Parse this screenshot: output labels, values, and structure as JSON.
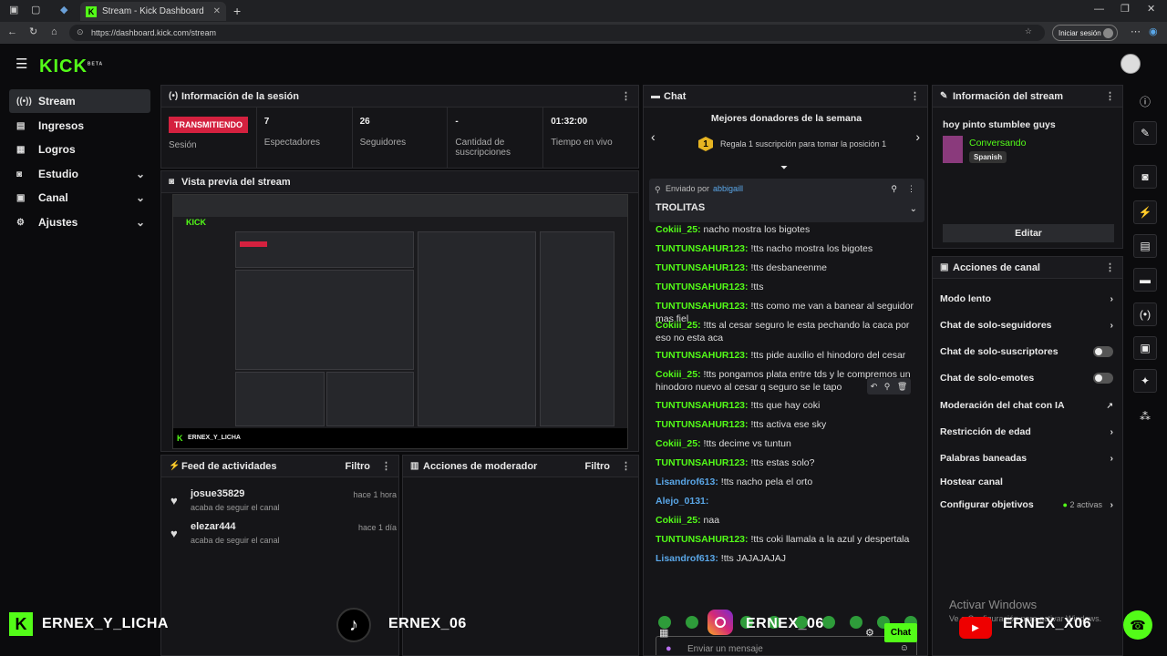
{
  "browser": {
    "tab_title": "Stream - Kick Dashboard",
    "url": "https://dashboard.kick.com/stream",
    "login_label": "Iniciar sesión"
  },
  "app": {
    "logo": "KICK",
    "logo_badge": "BETA"
  },
  "sidebar": {
    "items": [
      {
        "label": "Stream",
        "icon": "broadcast-icon",
        "active": true
      },
      {
        "label": "Ingresos",
        "icon": "money-icon"
      },
      {
        "label": "Logros",
        "icon": "trophy-icon"
      },
      {
        "label": "Estudio",
        "icon": "camera-icon",
        "expandable": true
      },
      {
        "label": "Canal",
        "icon": "tv-icon",
        "expandable": true
      },
      {
        "label": "Ajustes",
        "icon": "gear-icon",
        "expandable": true
      }
    ]
  },
  "session": {
    "title": "Información de la sesión",
    "live_badge": "TRANSMITIENDO",
    "live_label": "Sesión",
    "stats": [
      {
        "value": "7",
        "label": "Espectadores"
      },
      {
        "value": "26",
        "label": "Seguidores"
      },
      {
        "value": "-",
        "label": "Cantidad de suscripciones"
      },
      {
        "value": "01:32:00",
        "label": "Tiempo en vivo"
      }
    ]
  },
  "preview": {
    "title": "Vista previa del stream"
  },
  "overlays": {
    "kick_name": "ERNEX_Y_LICHA",
    "tiktok_name": "ERNEX_06",
    "instagram_name": "ERNEX_06",
    "youtube_name": "ERNEX_X06"
  },
  "feed": {
    "title": "Feed de actividades",
    "filter": "Filtro",
    "items": [
      {
        "name": "josue35829",
        "sub": "acaba de seguir el canal",
        "time": "hace 1 hora"
      },
      {
        "name": "elezar444",
        "sub": "acaba de seguir el canal",
        "time": "hace 1 día"
      }
    ]
  },
  "moderator": {
    "title": "Acciones de moderador",
    "filter": "Filtro"
  },
  "chat": {
    "title": "Chat",
    "donors_title": "Mejores donadores de la semana",
    "donors_text": "Regala 1 suscripción para tomar la posición 1",
    "donors_rank": "1",
    "pinned_by_label": "Enviado por",
    "pinned_by": "abbigaill",
    "pinned_text": "TROLITAS",
    "messages": [
      {
        "user": "Cokiii_25:",
        "text": "nacho mostra los bigotes",
        "color": "green"
      },
      {
        "user": "TUNTUNSAHUR123:",
        "text": "!tts nacho mostra los bigotes",
        "color": "green"
      },
      {
        "user": "TUNTUNSAHUR123:",
        "text": "!tts desbaneenme",
        "color": "green"
      },
      {
        "user": "TUNTUNSAHUR123:",
        "text": "!tts",
        "color": "green"
      },
      {
        "user": "TUNTUNSAHUR123:",
        "text": "!tts como me van a banear al seguidor mas fiel",
        "color": "green"
      },
      {
        "user": "Cokiii_25:",
        "text": "!tts al cesar seguro le esta pechando la caca por eso no esta aca",
        "color": "green"
      },
      {
        "user": "TUNTUNSAHUR123:",
        "text": "!tts pide auxilio el hinodoro del cesar",
        "color": "green"
      },
      {
        "user": "Cokiii_25:",
        "text": "!tts pongamos plata entre tds y le compremos un hinodoro nuevo al cesar q seguro se le tapo",
        "color": "green"
      },
      {
        "user": "TUNTUNSAHUR123:",
        "text": "!tts que hay coki",
        "color": "green"
      },
      {
        "user": "TUNTUNSAHUR123:",
        "text": "!tts activa ese sky",
        "color": "green"
      },
      {
        "user": "Cokiii_25:",
        "text": "!tts decime vs tuntun",
        "color": "green"
      },
      {
        "user": "TUNTUNSAHUR123:",
        "text": "!tts estas solo?",
        "color": "green"
      },
      {
        "user": "Lisandrof613:",
        "text": "!tts nacho pela el orto",
        "color": "blue"
      },
      {
        "user": "Alejo_0131:",
        "text": "",
        "color": "blue"
      },
      {
        "user": "Cokiii_25:",
        "text": "naa",
        "color": "green"
      },
      {
        "user": "TUNTUNSAHUR123:",
        "text": "!tts coki llamala a la azul y despertala",
        "color": "green"
      },
      {
        "user": "Lisandrof613:",
        "text": "!tts JAJAJAJAJ",
        "color": "blue"
      }
    ],
    "input_placeholder": "Enviar un mensaje",
    "send_label": "Chat"
  },
  "stream_info": {
    "title": "Información del stream",
    "stream_title": "hoy pinto stumblee guys",
    "category": "Conversando",
    "language": "Spanish",
    "edit_label": "Editar"
  },
  "channel_actions": {
    "title": "Acciones de canal",
    "items": [
      {
        "label": "Modo lento",
        "kind": "chevron"
      },
      {
        "label": "Chat de solo-seguidores",
        "kind": "chevron"
      },
      {
        "label": "Chat de solo-suscriptores",
        "kind": "toggle"
      },
      {
        "label": "Chat de solo-emotes",
        "kind": "toggle"
      },
      {
        "label": "Moderación del chat con IA",
        "kind": "external"
      },
      {
        "label": "Restricción de edad",
        "kind": "chevron"
      },
      {
        "label": "Palabras baneadas",
        "kind": "chevron"
      },
      {
        "label": "Hostear canal",
        "kind": "none"
      },
      {
        "label": "Configurar objetivos",
        "kind": "chevron",
        "extra": "2 activas"
      }
    ]
  },
  "watermark": {
    "title": "Activar Windows",
    "sub": "Ve a Configuración para activar Windows."
  },
  "colors": {
    "accent": "#53fc18",
    "live": "#d4213f"
  }
}
